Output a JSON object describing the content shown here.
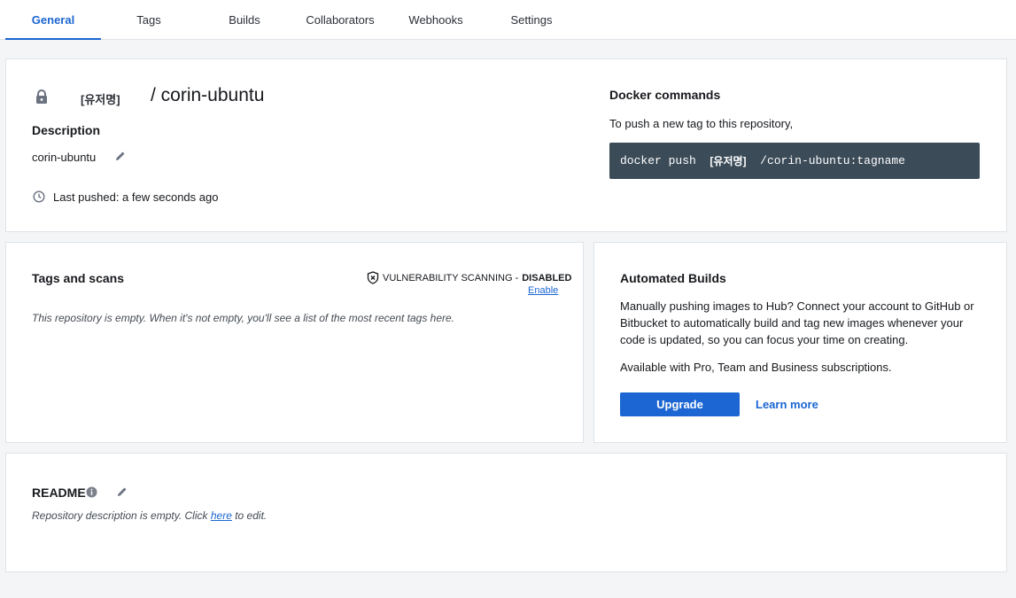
{
  "tabs": [
    {
      "label": "General",
      "active": true
    },
    {
      "label": "Tags"
    },
    {
      "label": "Builds"
    },
    {
      "label": "Collaborators"
    },
    {
      "label": "Webhooks"
    },
    {
      "label": "Settings"
    }
  ],
  "repo": {
    "username": "[유저명]",
    "name": "/ corin-ubuntu",
    "description_heading": "Description",
    "description": "corin-ubuntu",
    "last_pushed": "Last pushed: a few seconds ago"
  },
  "docker": {
    "heading": "Docker commands",
    "subtext": "To push a new tag to this repository,",
    "cmd_prefix": "docker push  ",
    "cmd_user": "[유저명]",
    "cmd_suffix": "  /corin-ubuntu:tagname"
  },
  "tags_scans": {
    "heading": "Tags and scans",
    "scan_label": "VULNERABILITY SCANNING - ",
    "scan_status": "DISABLED",
    "enable_link": "Enable",
    "empty_text": "This repository is empty. When it's not empty, you'll see a list of the most recent tags here."
  },
  "automated": {
    "heading": "Automated Builds",
    "paragraph1": "Manually pushing images to Hub? Connect your account to GitHub or Bitbucket to automatically build and tag new images whenever your code is updated, so you can focus your time on creating.",
    "paragraph2": "Available with Pro, Team and Business subscriptions.",
    "upgrade_label": "Upgrade",
    "learn_more": "Learn more"
  },
  "readme": {
    "heading": "README",
    "empty_prefix": "Repository description is empty. Click ",
    "here_link": "here",
    "empty_suffix": " to edit."
  },
  "colors": {
    "accent": "#1b66d2",
    "command_bg": "#3b4b58",
    "page_bg": "#f4f5f7"
  }
}
